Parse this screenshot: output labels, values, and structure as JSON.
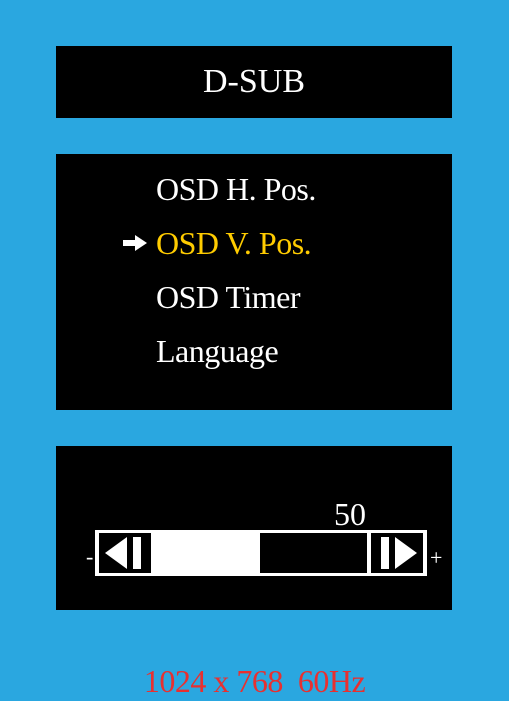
{
  "title": "D-SUB",
  "menu": {
    "items": [
      {
        "label": "OSD H. Pos.",
        "selected": false
      },
      {
        "label": "OSD V. Pos.",
        "selected": true
      },
      {
        "label": "OSD Timer",
        "selected": false
      },
      {
        "label": "Language",
        "selected": false
      }
    ]
  },
  "slider": {
    "value": "50",
    "level_fraction": 0.5,
    "min_symbol": "-",
    "max_symbol": "+"
  },
  "status": {
    "resolution": "1024 x 768  60Hz"
  },
  "colors": {
    "background": "#2aa7e0",
    "panel": "#000000",
    "text": "#ffffff",
    "selected": "#ffcc00",
    "status": "#e83030"
  }
}
